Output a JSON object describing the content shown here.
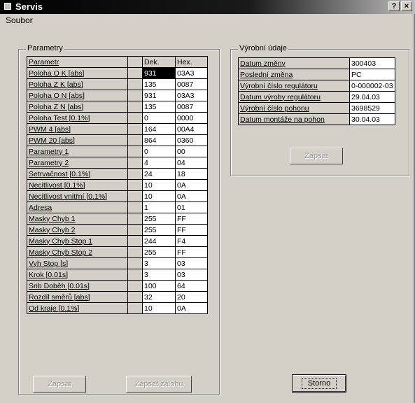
{
  "window": {
    "title": "Servis",
    "help_label": "?",
    "close_label": "×"
  },
  "menu": {
    "soubor": "Soubor"
  },
  "params": {
    "group_label": "Parametry",
    "header": {
      "name": "Parametr",
      "dek": "Dek.",
      "hex": "Hex."
    },
    "rows": [
      {
        "name": "Poloha  O  K [abs]",
        "dek": "931",
        "hex": "03A3"
      },
      {
        "name": "Poloha  Z  K [abs]",
        "dek": "135",
        "hex": "0087"
      },
      {
        "name": "Poloha  O  N [abs]",
        "dek": "931",
        "hex": "03A3"
      },
      {
        "name": "Poloha  Z  N [abs]",
        "dek": "135",
        "hex": "0087"
      },
      {
        "name": "Poloha  Test [0.1%]",
        "dek": "0",
        "hex": "0000"
      },
      {
        "name": "PWM  4 [abs]",
        "dek": "164",
        "hex": "00A4"
      },
      {
        "name": "PWM  20 [abs]",
        "dek": "864",
        "hex": "0360"
      },
      {
        "name": "Parametry  1",
        "dek": "0",
        "hex": "00"
      },
      {
        "name": "Parametry  2",
        "dek": "4",
        "hex": "04"
      },
      {
        "name": "Setrvačnost [0.1%]",
        "dek": "24",
        "hex": "18"
      },
      {
        "name": "Necitlivost [0.1%]",
        "dek": "10",
        "hex": "0A"
      },
      {
        "name": "Necitlivost vnitřní [0.1%]",
        "dek": "10",
        "hex": "0A"
      },
      {
        "name": "Adresa",
        "dek": "1",
        "hex": "01"
      },
      {
        "name": "Masky  Chyb  1",
        "dek": "255",
        "hex": "FF"
      },
      {
        "name": "Masky  Chyb  2",
        "dek": "255",
        "hex": "FF"
      },
      {
        "name": "Masky  Chyb  Stop  1",
        "dek": "244",
        "hex": "F4"
      },
      {
        "name": "Masky  Chyb  Stop  2",
        "dek": "255",
        "hex": "FF"
      },
      {
        "name": "Vyh  Stop [s]",
        "dek": "3",
        "hex": "03"
      },
      {
        "name": "Krok [0.01s]",
        "dek": "3",
        "hex": "03"
      },
      {
        "name": "Srib  Doběh [0.01s]",
        "dek": "100",
        "hex": "64"
      },
      {
        "name": "Rozdíl směrů [abs]",
        "dek": "32",
        "hex": "20"
      },
      {
        "name": "Od kraje [0.1%]",
        "dek": "10",
        "hex": "0A"
      }
    ],
    "zapsat_label": "Zapsat",
    "zapsat_zalohu_label": "Zapsat zálohu"
  },
  "production": {
    "group_label": "Výrobní údaje",
    "rows": [
      {
        "label": "Datum změny",
        "value": "300403"
      },
      {
        "label": "Poslední změna",
        "value": "PC"
      },
      {
        "label": "Výrobní číslo regulátoru",
        "value": "0-000002-03"
      },
      {
        "label": "Datum výroby regulátoru",
        "value": "29.04.03"
      },
      {
        "label": "Výrobní číslo pohonu",
        "value": "3698529"
      },
      {
        "label": "Datum montáže na pohon",
        "value": "30.04.03"
      }
    ],
    "zapsat_label": "Zapsat"
  },
  "storno_label": "Storno"
}
